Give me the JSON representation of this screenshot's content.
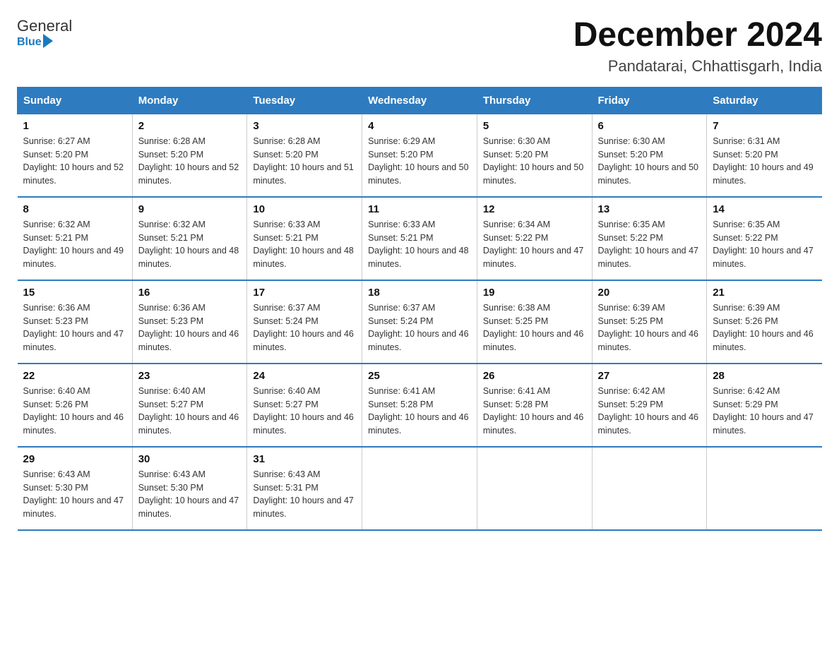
{
  "logo": {
    "general": "General",
    "blue": "Blue",
    "arrow": "▶"
  },
  "title": "December 2024",
  "location": "Pandatarai, Chhattisgarh, India",
  "days_of_week": [
    "Sunday",
    "Monday",
    "Tuesday",
    "Wednesday",
    "Thursday",
    "Friday",
    "Saturday"
  ],
  "weeks": [
    [
      {
        "day": "1",
        "sunrise": "6:27 AM",
        "sunset": "5:20 PM",
        "daylight": "10 hours and 52 minutes."
      },
      {
        "day": "2",
        "sunrise": "6:28 AM",
        "sunset": "5:20 PM",
        "daylight": "10 hours and 52 minutes."
      },
      {
        "day": "3",
        "sunrise": "6:28 AM",
        "sunset": "5:20 PM",
        "daylight": "10 hours and 51 minutes."
      },
      {
        "day": "4",
        "sunrise": "6:29 AM",
        "sunset": "5:20 PM",
        "daylight": "10 hours and 50 minutes."
      },
      {
        "day": "5",
        "sunrise": "6:30 AM",
        "sunset": "5:20 PM",
        "daylight": "10 hours and 50 minutes."
      },
      {
        "day": "6",
        "sunrise": "6:30 AM",
        "sunset": "5:20 PM",
        "daylight": "10 hours and 50 minutes."
      },
      {
        "day": "7",
        "sunrise": "6:31 AM",
        "sunset": "5:20 PM",
        "daylight": "10 hours and 49 minutes."
      }
    ],
    [
      {
        "day": "8",
        "sunrise": "6:32 AM",
        "sunset": "5:21 PM",
        "daylight": "10 hours and 49 minutes."
      },
      {
        "day": "9",
        "sunrise": "6:32 AM",
        "sunset": "5:21 PM",
        "daylight": "10 hours and 48 minutes."
      },
      {
        "day": "10",
        "sunrise": "6:33 AM",
        "sunset": "5:21 PM",
        "daylight": "10 hours and 48 minutes."
      },
      {
        "day": "11",
        "sunrise": "6:33 AM",
        "sunset": "5:21 PM",
        "daylight": "10 hours and 48 minutes."
      },
      {
        "day": "12",
        "sunrise": "6:34 AM",
        "sunset": "5:22 PM",
        "daylight": "10 hours and 47 minutes."
      },
      {
        "day": "13",
        "sunrise": "6:35 AM",
        "sunset": "5:22 PM",
        "daylight": "10 hours and 47 minutes."
      },
      {
        "day": "14",
        "sunrise": "6:35 AM",
        "sunset": "5:22 PM",
        "daylight": "10 hours and 47 minutes."
      }
    ],
    [
      {
        "day": "15",
        "sunrise": "6:36 AM",
        "sunset": "5:23 PM",
        "daylight": "10 hours and 47 minutes."
      },
      {
        "day": "16",
        "sunrise": "6:36 AM",
        "sunset": "5:23 PM",
        "daylight": "10 hours and 46 minutes."
      },
      {
        "day": "17",
        "sunrise": "6:37 AM",
        "sunset": "5:24 PM",
        "daylight": "10 hours and 46 minutes."
      },
      {
        "day": "18",
        "sunrise": "6:37 AM",
        "sunset": "5:24 PM",
        "daylight": "10 hours and 46 minutes."
      },
      {
        "day": "19",
        "sunrise": "6:38 AM",
        "sunset": "5:25 PM",
        "daylight": "10 hours and 46 minutes."
      },
      {
        "day": "20",
        "sunrise": "6:39 AM",
        "sunset": "5:25 PM",
        "daylight": "10 hours and 46 minutes."
      },
      {
        "day": "21",
        "sunrise": "6:39 AM",
        "sunset": "5:26 PM",
        "daylight": "10 hours and 46 minutes."
      }
    ],
    [
      {
        "day": "22",
        "sunrise": "6:40 AM",
        "sunset": "5:26 PM",
        "daylight": "10 hours and 46 minutes."
      },
      {
        "day": "23",
        "sunrise": "6:40 AM",
        "sunset": "5:27 PM",
        "daylight": "10 hours and 46 minutes."
      },
      {
        "day": "24",
        "sunrise": "6:40 AM",
        "sunset": "5:27 PM",
        "daylight": "10 hours and 46 minutes."
      },
      {
        "day": "25",
        "sunrise": "6:41 AM",
        "sunset": "5:28 PM",
        "daylight": "10 hours and 46 minutes."
      },
      {
        "day": "26",
        "sunrise": "6:41 AM",
        "sunset": "5:28 PM",
        "daylight": "10 hours and 46 minutes."
      },
      {
        "day": "27",
        "sunrise": "6:42 AM",
        "sunset": "5:29 PM",
        "daylight": "10 hours and 46 minutes."
      },
      {
        "day": "28",
        "sunrise": "6:42 AM",
        "sunset": "5:29 PM",
        "daylight": "10 hours and 47 minutes."
      }
    ],
    [
      {
        "day": "29",
        "sunrise": "6:43 AM",
        "sunset": "5:30 PM",
        "daylight": "10 hours and 47 minutes."
      },
      {
        "day": "30",
        "sunrise": "6:43 AM",
        "sunset": "5:30 PM",
        "daylight": "10 hours and 47 minutes."
      },
      {
        "day": "31",
        "sunrise": "6:43 AM",
        "sunset": "5:31 PM",
        "daylight": "10 hours and 47 minutes."
      },
      null,
      null,
      null,
      null
    ]
  ],
  "labels": {
    "sunrise_prefix": "Sunrise: ",
    "sunset_prefix": "Sunset: ",
    "daylight_prefix": "Daylight: "
  }
}
